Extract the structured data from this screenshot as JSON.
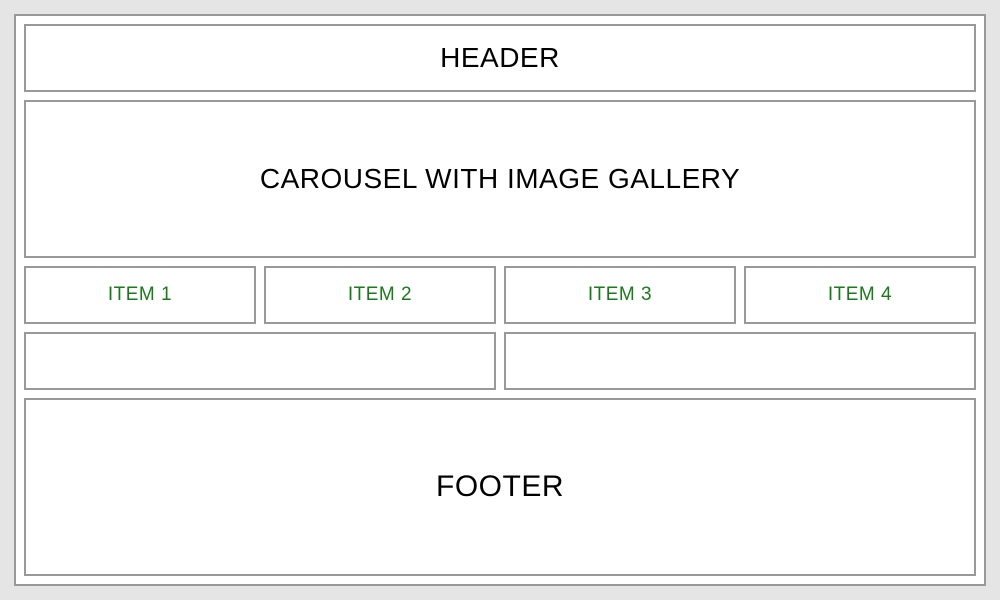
{
  "header": {
    "title": "HEADER"
  },
  "carousel": {
    "label": "CAROUSEL WITH IMAGE GALLERY"
  },
  "items": [
    {
      "label": "ITEM 1"
    },
    {
      "label": "ITEM 2"
    },
    {
      "label": "ITEM 3"
    },
    {
      "label": "ITEM 4"
    }
  ],
  "panels": [
    {
      "label": ""
    },
    {
      "label": ""
    }
  ],
  "footer": {
    "label": "FOOTER"
  },
  "colors": {
    "item_text": "#1a7a1a",
    "border": "#999999",
    "background": "#e5e5e5"
  }
}
